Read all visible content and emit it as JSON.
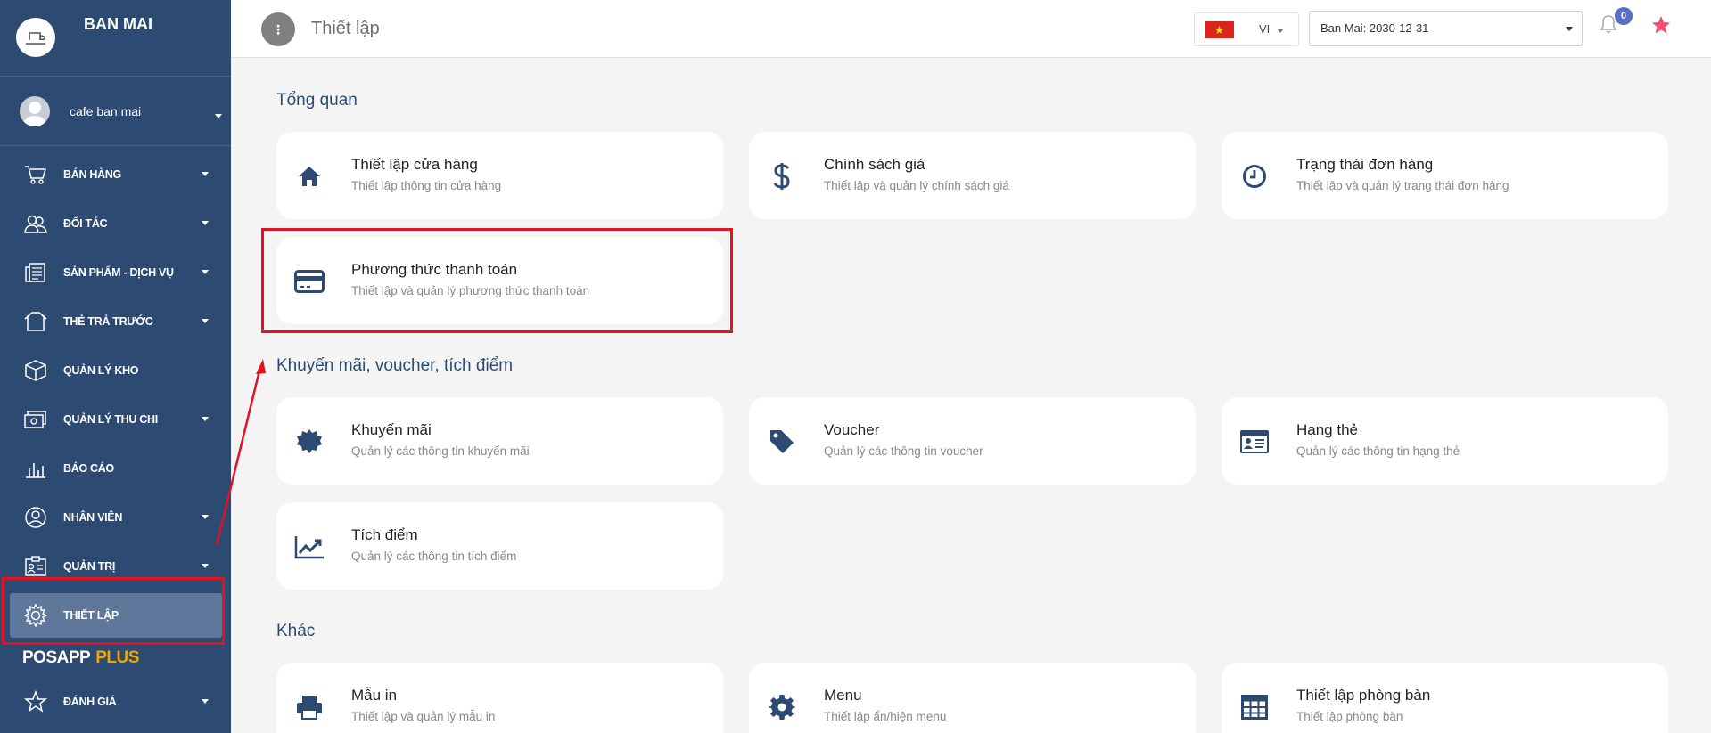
{
  "sidebar": {
    "brand_name": "BAN MAI",
    "user_name": "cafe ban mai",
    "items": [
      {
        "label": "BÁN HÀNG",
        "icon": "cart-icon"
      },
      {
        "label": "ĐỐI TÁC",
        "icon": "partners-icon"
      },
      {
        "label": "SẢN PHẨM - DỊCH VỤ",
        "icon": "products-icon"
      },
      {
        "label": "THẺ TRẢ TRƯỚC",
        "icon": "prepaid-card-icon"
      },
      {
        "label": "QUẢN LÝ KHO",
        "icon": "warehouse-box-icon"
      },
      {
        "label": "QUẢN LÝ THU CHI",
        "icon": "cash-icon"
      },
      {
        "label": "BÁO CÁO",
        "icon": "report-chart-icon"
      },
      {
        "label": "NHÂN VIÊN",
        "icon": "employee-icon"
      },
      {
        "label": "QUẢN TRỊ",
        "icon": "admin-icon"
      },
      {
        "label": "THIẾT LẬP",
        "icon": "settings-gear-icon"
      }
    ],
    "posapp": {
      "name": "POSAPP",
      "plus": "PLUS"
    },
    "rate_label": "ĐÁNH GIÁ"
  },
  "header": {
    "title": "Thiết lập",
    "language": "VI",
    "store_selected": "Ban Mai: 2030-12-31",
    "notification_count": "0"
  },
  "sections": {
    "overview": {
      "title": "Tổng quan",
      "cards": [
        {
          "title": "Thiết lập cửa hàng",
          "desc": "Thiết lập thông tin cửa hàng",
          "icon": "home-icon"
        },
        {
          "title": "Chính sách giá",
          "desc": "Thiết lập và quản lý chính sách giá",
          "icon": "dollar-icon"
        },
        {
          "title": "Trạng thái đơn hàng",
          "desc": "Thiết lập và quản lý trạng thái đơn hàng",
          "icon": "clock-icon"
        },
        {
          "title": "Phương thức thanh toán",
          "desc": "Thiết lập và quản lý phương thức thanh toán",
          "icon": "credit-card-icon"
        }
      ]
    },
    "promo": {
      "title": "Khuyến mãi, voucher, tích điểm",
      "cards": [
        {
          "title": "Khuyến mãi",
          "desc": "Quản lý các thông tin khuyến mãi",
          "icon": "certificate-badge-icon"
        },
        {
          "title": "Voucher",
          "desc": "Quản lý các thông tin voucher",
          "icon": "tag-icon"
        },
        {
          "title": "Hạng thẻ",
          "desc": "Quản lý các thông tin hạng thẻ",
          "icon": "id-card-icon"
        },
        {
          "title": "Tích điểm",
          "desc": "Quản lý các thông tin tích điểm",
          "icon": "trend-chart-icon"
        }
      ]
    },
    "other": {
      "title": "Khác",
      "cards": [
        {
          "title": "Mẫu in",
          "desc": "Thiết lập và quản lý mẫu in",
          "icon": "printer-icon"
        },
        {
          "title": "Menu",
          "desc": "Thiết lập ẩn/hiện menu",
          "icon": "cog-icon"
        },
        {
          "title": "Thiết lập phòng bàn",
          "desc": "Thiết lập phòng bàn",
          "icon": "table-grid-icon"
        }
      ]
    }
  },
  "colors": {
    "sidebar_bg": "#2c4a72",
    "sidebar_active": "#5f779a",
    "accent_plus": "#f0a500",
    "highlight": "#e0141e",
    "badge": "#5b6ec8",
    "star": "#f0506e"
  }
}
